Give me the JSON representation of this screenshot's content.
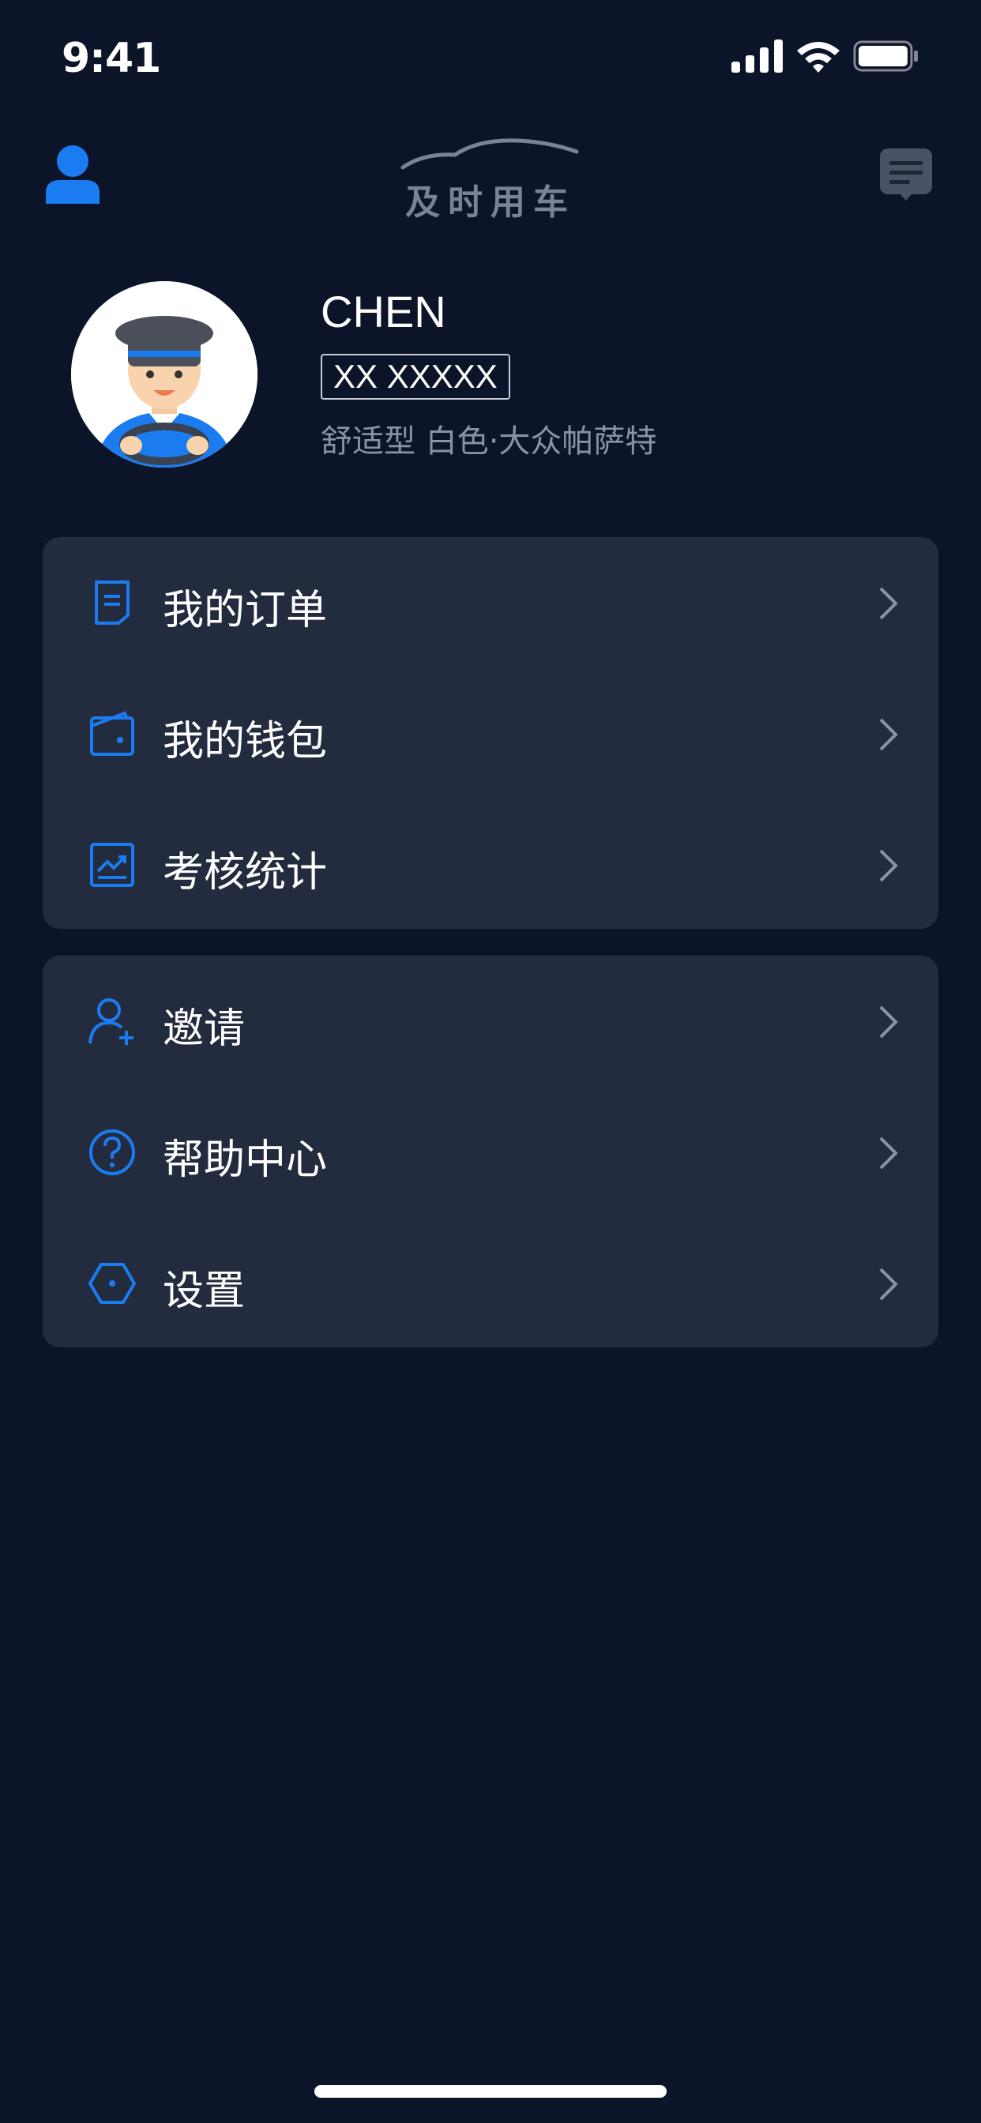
{
  "status_bar": {
    "time": "9:41"
  },
  "header": {
    "logo_text": "及时用车"
  },
  "profile": {
    "name": "CHEN",
    "plate": "XX XXXXX",
    "car_info": "舒适型 白色·大众帕萨特"
  },
  "menu_group_1": [
    {
      "label": "我的订单",
      "icon": "order-icon"
    },
    {
      "label": "我的钱包",
      "icon": "wallet-icon"
    },
    {
      "label": "考核统计",
      "icon": "stats-icon"
    }
  ],
  "menu_group_2": [
    {
      "label": "邀请",
      "icon": "invite-icon"
    },
    {
      "label": "帮助中心",
      "icon": "help-icon"
    },
    {
      "label": "设置",
      "icon": "settings-icon"
    }
  ],
  "colors": {
    "background": "#0c1429",
    "card": "#232c3f",
    "accent": "#1a7cf0",
    "muted_text": "#8a93a6"
  }
}
